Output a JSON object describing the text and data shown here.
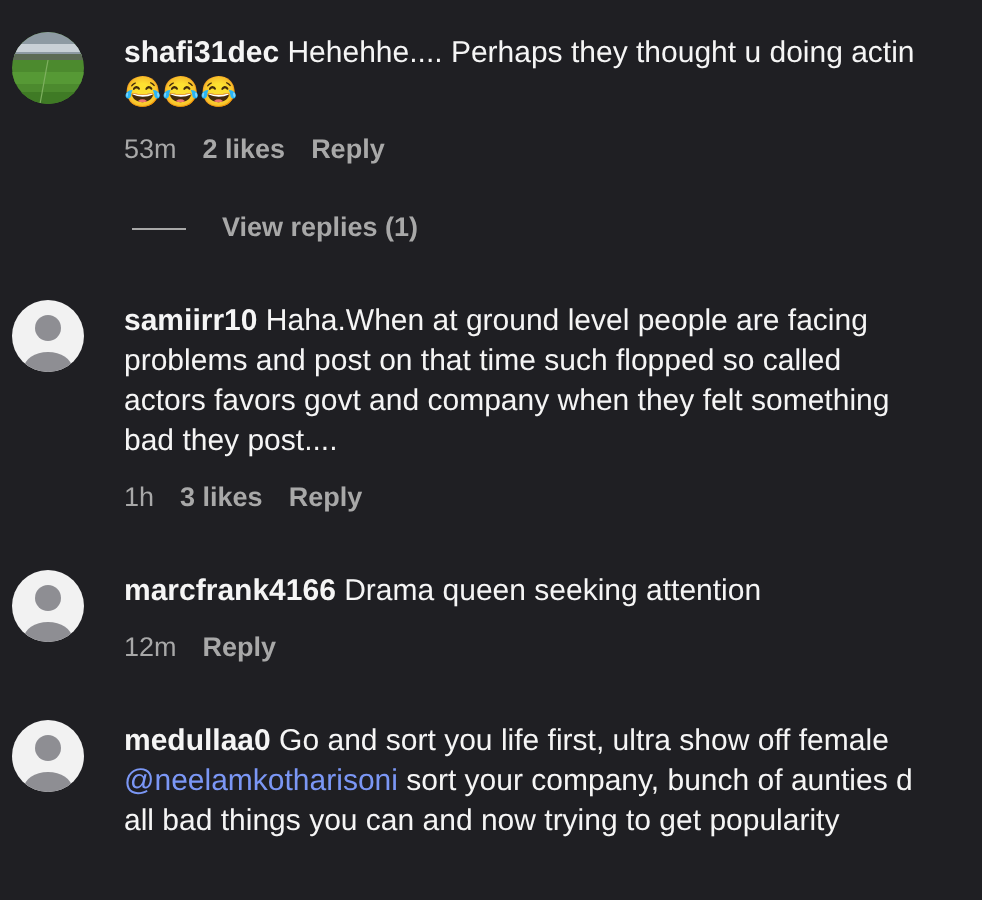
{
  "comments": [
    {
      "avatar": {
        "kind": "picture"
      },
      "username": "shafi31dec",
      "lines": [
        [
          {
            "kind": "plain",
            "text": "Hehehhe.... Perhaps they thought u doing actin"
          }
        ],
        [
          {
            "kind": "plain",
            "text": "😂😂😂"
          }
        ]
      ],
      "time": "53m",
      "likes": "2 likes",
      "reply": "Reply",
      "view_replies": "View replies (1)"
    },
    {
      "avatar": {
        "kind": "silhouette"
      },
      "username": "samiirr10",
      "lines": [
        [
          {
            "kind": "plain",
            "text": "Haha.When at ground level people are facing"
          }
        ],
        [
          {
            "kind": "plain",
            "text": "problems and post on that time such flopped so called"
          }
        ],
        [
          {
            "kind": "plain",
            "text": "actors favors govt and company when they felt something"
          }
        ],
        [
          {
            "kind": "plain",
            "text": "bad they post...."
          }
        ]
      ],
      "time": "1h",
      "likes": "3 likes",
      "reply": "Reply"
    },
    {
      "avatar": {
        "kind": "silhouette"
      },
      "username": "marcfrank4166",
      "lines": [
        [
          {
            "kind": "plain",
            "text": "Drama queen seeking attention"
          }
        ]
      ],
      "time": "12m",
      "reply": "Reply"
    },
    {
      "avatar": {
        "kind": "silhouette"
      },
      "username": "medullaa0",
      "lines": [
        [
          {
            "kind": "plain",
            "text": "Go and sort you life first, ultra show off female"
          }
        ],
        [
          {
            "kind": "mention",
            "text": "@neelamkotharisoni"
          },
          {
            "kind": "plain",
            "text": " sort your company, bunch of aunties d"
          }
        ],
        [
          {
            "kind": "plain",
            "text": "all bad things you can and now trying to get popularity"
          }
        ]
      ]
    }
  ]
}
